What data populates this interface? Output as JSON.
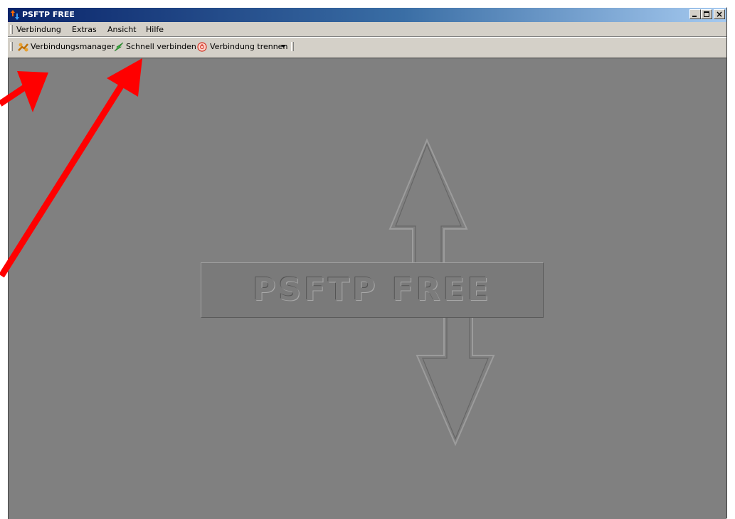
{
  "window": {
    "title": "PSFTP FREE",
    "controls": {
      "minimize_icon": "minimize-icon",
      "maximize_icon": "maximize-icon",
      "close_icon": "close-icon"
    }
  },
  "menubar": {
    "items": [
      {
        "label": "Verbindung"
      },
      {
        "label": "Extras"
      },
      {
        "label": "Ansicht"
      },
      {
        "label": "Hilfe"
      }
    ]
  },
  "toolbar": {
    "buttons": [
      {
        "label": "Verbindungsmanager",
        "icon": "connection-manager-icon"
      },
      {
        "label": "Schnell verbinden",
        "icon": "quick-connect-icon"
      },
      {
        "label": "Verbindung trennen",
        "icon": "disconnect-icon"
      }
    ],
    "overflow_icon": "toolbar-overflow-chevron-icon"
  },
  "logo": {
    "text": "PSFTP  FREE"
  },
  "colors": {
    "titlebar_start": "#0a246a",
    "titlebar_end": "#a6caf0",
    "client_background": "#808080",
    "annotation_arrow": "#ff0000"
  }
}
